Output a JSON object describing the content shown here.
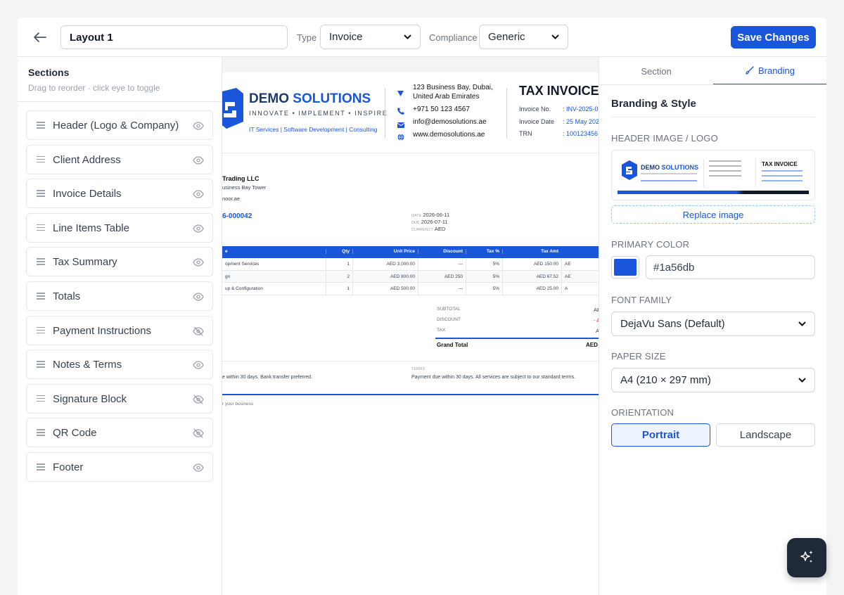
{
  "topbar": {
    "layout_name": "Layout 1",
    "type_label": "Type",
    "type_value": "Invoice",
    "compliance_label": "Compliance",
    "compliance_value": "Generic",
    "save_label": "Save Changes"
  },
  "sections": {
    "title": "Sections",
    "subtitle": "Drag to reorder · click eye to toggle",
    "items": [
      {
        "label": "Header (Logo & Company)",
        "visible": true
      },
      {
        "label": "Client Address",
        "visible": true
      },
      {
        "label": "Invoice Details",
        "visible": true
      },
      {
        "label": "Line Items Table",
        "visible": true
      },
      {
        "label": "Tax Summary",
        "visible": true
      },
      {
        "label": "Totals",
        "visible": true
      },
      {
        "label": "Payment Instructions",
        "visible": false
      },
      {
        "label": "Notes & Terms",
        "visible": true
      },
      {
        "label": "Signature Block",
        "visible": false
      },
      {
        "label": "QR Code",
        "visible": false
      },
      {
        "label": "Footer",
        "visible": true
      }
    ]
  },
  "preview": {
    "company_demo": "DEMO",
    "company_solutions": "SOLUTIONS",
    "tagline": "INNOVATE • IMPLEMENT • INSPIRE",
    "services": "IT Services | Software Development | Consulting",
    "address_line1": "123 Business Bay, Dubai,",
    "address_line2": "United Arab Emirates",
    "phone": "+971 50 123 4567",
    "email": "info@demosolutions.ae",
    "website": "www.demosolutions.ae",
    "doc_title": "TAX INVOICE",
    "invoice_no_label": "Invoice No.",
    "invoice_no_value": ": INV-2025-0",
    "invoice_date_label": "Invoice Date",
    "invoice_date_value": ": 25 May 202",
    "trn_label": "TRN",
    "trn_value": ": 100123456",
    "client_name": "Trading LLC",
    "client_addr": "usiness Bay Tower",
    "client_email": "noor.ae",
    "invoice_number": "6-000042",
    "date_label": "DATE",
    "date_value": "2026-06-11",
    "due_label": "DUE",
    "due_value": "2026-07-11",
    "currency_label": "CURRENCY",
    "currency_value": "AED",
    "table_headers": [
      "e",
      "Qty",
      "Unit Price",
      "Discount",
      "Tax %",
      "Tax Amt",
      ""
    ],
    "rows": [
      [
        "opment Services",
        "1",
        "AED 3,000.00",
        "—",
        "5%",
        "AED 150.00",
        "AE"
      ],
      [
        "gn",
        "2",
        "AED 800.00",
        "AED 250",
        "5%",
        "AED 67.52",
        "AE"
      ],
      [
        "up & Configuration",
        "1",
        "AED 500.00",
        "—",
        "5%",
        "AED 25.00",
        "A"
      ]
    ],
    "subtotal_label": "SUBTOTAL",
    "subtotal_value": "AE",
    "discount_label": "DISCOUNT",
    "discount_value": "- A",
    "tax_label": "TAX",
    "tax_value": "A",
    "grand_total_label": "Grand Total",
    "grand_total_value": "AED",
    "notes_text": "e within 30 days. Bank transfer preferred.",
    "terms_label": "TERMS",
    "terms_text": "Payment due within 30 days. All services are subject to our standard terms.",
    "footer_text": "r your business"
  },
  "branding": {
    "tab_section": "Section",
    "tab_branding": "Branding",
    "heading": "Branding & Style",
    "header_image_label": "HEADER IMAGE / LOGO",
    "thumb_demo": "DEMO",
    "thumb_solutions": "SOLUTIONS",
    "thumb_title": "TAX INVOICE",
    "replace_label": "Replace image",
    "primary_color_label": "PRIMARY COLOR",
    "primary_color": "#1a56db",
    "font_family_label": "FONT FAMILY",
    "font_family_value": "DejaVu Sans (Default)",
    "paper_size_label": "PAPER SIZE",
    "paper_size_value": "A4 (210 × 297 mm)",
    "orientation_label": "ORIENTATION",
    "portrait_label": "Portrait",
    "landscape_label": "Landscape"
  }
}
